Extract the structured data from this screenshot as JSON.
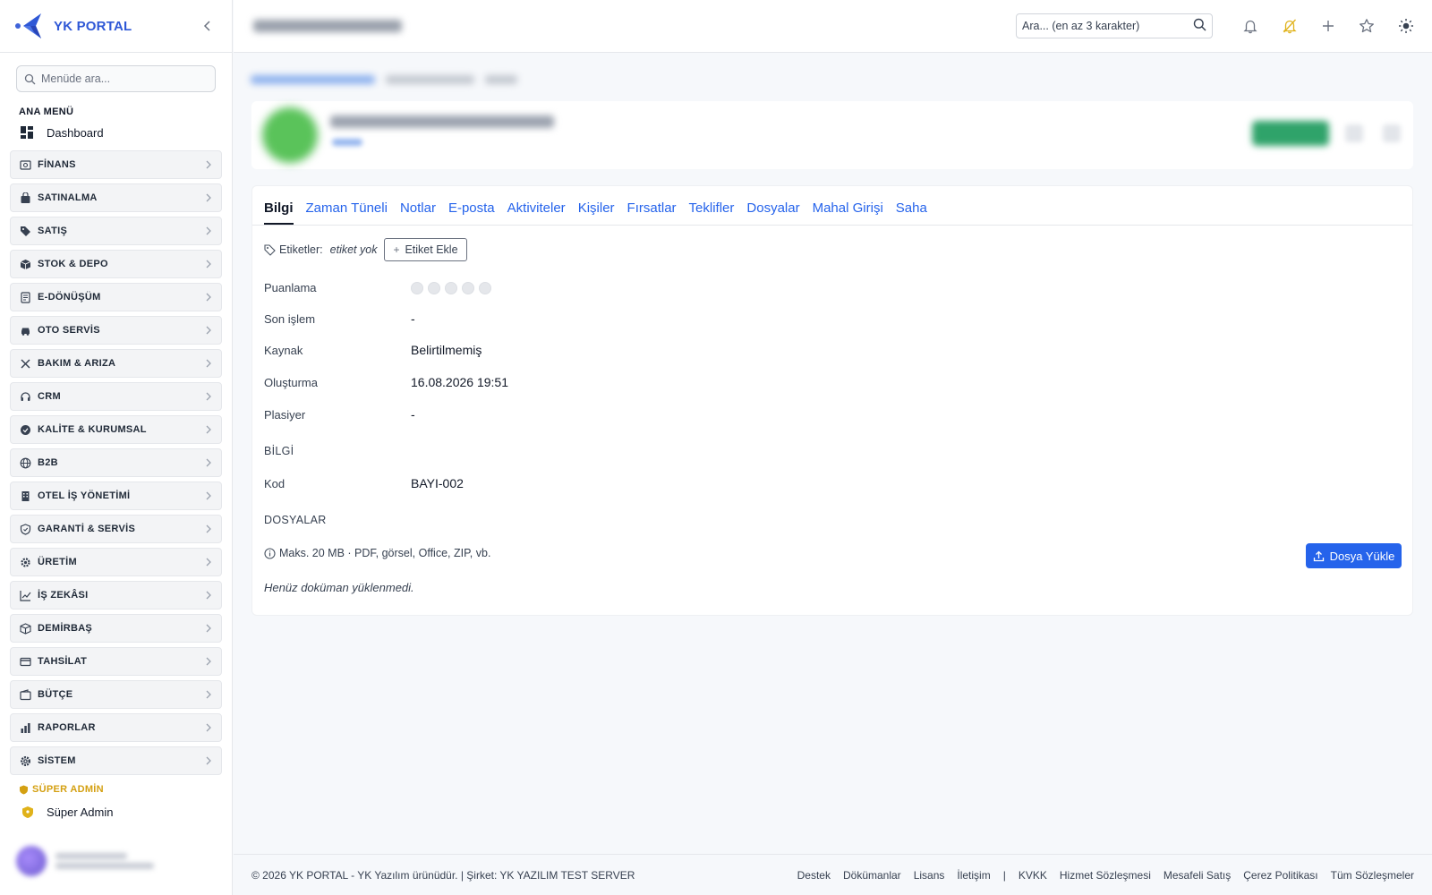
{
  "brand": {
    "name": "YK PORTAL"
  },
  "sidebar": {
    "search_placeholder": "Menüde ara...",
    "main_section": "ANA MENÜ",
    "dashboard": "Dashboard",
    "items": [
      {
        "label": "FİNANS",
        "icon": "finance-icon"
      },
      {
        "label": "SATINALMA",
        "icon": "shopping-bag-icon"
      },
      {
        "label": "SATIŞ",
        "icon": "tag-icon"
      },
      {
        "label": "STOK & DEPO",
        "icon": "box-icon"
      },
      {
        "label": "E-DÖNÜŞÜM",
        "icon": "document-icon"
      },
      {
        "label": "OTO SERVİS",
        "icon": "car-icon"
      },
      {
        "label": "BAKIM & ARIZA",
        "icon": "tools-icon"
      },
      {
        "label": "CRM",
        "icon": "headset-icon"
      },
      {
        "label": "KALİTE & KURUMSAL",
        "icon": "badge-check-icon"
      },
      {
        "label": "B2B",
        "icon": "globe-icon"
      },
      {
        "label": "OTEL İŞ YÖNETİMİ",
        "icon": "building-icon"
      },
      {
        "label": "GARANTİ & SERVİS",
        "icon": "shield-icon"
      },
      {
        "label": "ÜRETİM",
        "icon": "gear-icon"
      },
      {
        "label": "İŞ ZEKÂSI",
        "icon": "chart-line-icon"
      },
      {
        "label": "DEMİRBAŞ",
        "icon": "cube-icon"
      },
      {
        "label": "TAHSİLAT",
        "icon": "credit-card-icon"
      },
      {
        "label": "BÜTÇE",
        "icon": "wallet-icon"
      },
      {
        "label": "RAPORLAR",
        "icon": "bar-chart-icon"
      },
      {
        "label": "SİSTEM",
        "icon": "cog-icon"
      }
    ],
    "super_section": "SÜPER ADMİN",
    "super_item": "Süper Admin"
  },
  "topbar": {
    "search_placeholder": "Ara... (en az 3 karakter)"
  },
  "tabs": [
    "Bilgi",
    "Zaman Tüneli",
    "Notlar",
    "E-posta",
    "Aktiviteler",
    "Kişiler",
    "Fırsatlar",
    "Teklifler",
    "Dosyalar",
    "Mahal Girişi",
    "Saha"
  ],
  "active_tab": "Bilgi",
  "tags": {
    "label": "Etiketler:",
    "value": "etiket yok",
    "add_button": "Etiket Ekle"
  },
  "fields": {
    "rating_label": "Puanlama",
    "rating_value": 0,
    "rating_max": 5,
    "last_action_label": "Son işlem",
    "last_action_value": "-",
    "source_label": "Kaynak",
    "source_value": "Belirtilmemiş",
    "created_label": "Oluşturma",
    "created_value": "16.08.2026 19:51",
    "salesperson_label": "Plasiyer",
    "salesperson_value": "-"
  },
  "info_section": {
    "heading": "BİLGİ",
    "code_label": "Kod",
    "code_value": "BAYI-002"
  },
  "files_section": {
    "heading": "DOSYALAR",
    "note": "Maks. 20 MB · PDF, görsel, Office, ZIP, vb.",
    "upload_button": "Dosya Yükle",
    "empty": "Henüz doküman yüklenmedi."
  },
  "footer": {
    "copyright": "© 2026 YK PORTAL - YK Yazılım ürünüdür. | Şirket: YK YAZILIM TEST SERVER",
    "links_left": [
      "Destek",
      "Dökümanlar",
      "Lisans",
      "İletişim"
    ],
    "separator": "|",
    "links_right": [
      "KVKK",
      "Hizmet Sözleşmesi",
      "Mesafeli Satış",
      "Çerez Politikası",
      "Tüm Sözleşmeler"
    ]
  },
  "colors": {
    "accent": "#2563eb",
    "brand": "#2f58d6",
    "super_admin": "#d4a012",
    "warning_bell": "#e0b21a"
  }
}
